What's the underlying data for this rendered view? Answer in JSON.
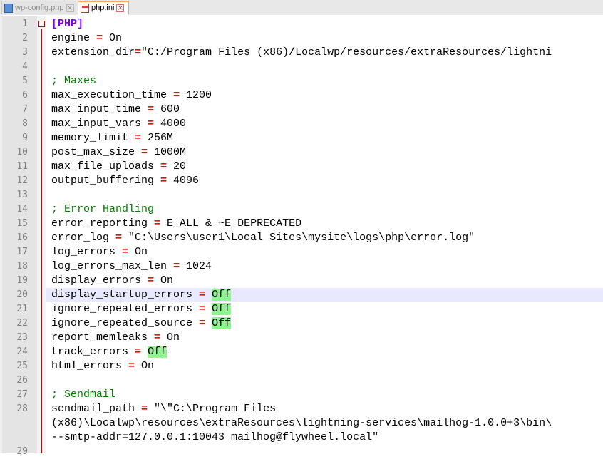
{
  "tabs": [
    {
      "label": "wp-config.php",
      "close": "×",
      "active": false
    },
    {
      "label": "php.ini",
      "close": "×",
      "active": true
    }
  ],
  "lines": [
    {
      "n": "1",
      "segs": [
        [
          "sec",
          "[PHP]"
        ]
      ]
    },
    {
      "n": "2",
      "segs": [
        [
          "",
          "engine "
        ],
        [
          "op",
          "="
        ],
        [
          "",
          " On"
        ]
      ]
    },
    {
      "n": "3",
      "segs": [
        [
          "",
          "extension_dir"
        ],
        [
          "op",
          "="
        ],
        [
          "",
          "\"C:/Program Files (x86)/Localwp/resources/extraResources/lightni"
        ]
      ]
    },
    {
      "n": "4",
      "segs": []
    },
    {
      "n": "5",
      "segs": [
        [
          "cmt",
          "; Maxes"
        ]
      ]
    },
    {
      "n": "6",
      "segs": [
        [
          "",
          "max_execution_time "
        ],
        [
          "op",
          "="
        ],
        [
          "",
          " 1200"
        ]
      ]
    },
    {
      "n": "7",
      "segs": [
        [
          "",
          "max_input_time "
        ],
        [
          "op",
          "="
        ],
        [
          "",
          " 600"
        ]
      ]
    },
    {
      "n": "8",
      "segs": [
        [
          "",
          "max_input_vars "
        ],
        [
          "op",
          "="
        ],
        [
          "",
          " 4000"
        ]
      ]
    },
    {
      "n": "9",
      "segs": [
        [
          "",
          "memory_limit "
        ],
        [
          "op",
          "="
        ],
        [
          "",
          " 256M"
        ]
      ]
    },
    {
      "n": "10",
      "segs": [
        [
          "",
          "post_max_size "
        ],
        [
          "op",
          "="
        ],
        [
          "",
          " 1000M"
        ]
      ]
    },
    {
      "n": "11",
      "segs": [
        [
          "",
          "max_file_uploads "
        ],
        [
          "op",
          "="
        ],
        [
          "",
          " 20"
        ]
      ]
    },
    {
      "n": "12",
      "segs": [
        [
          "",
          "output_buffering "
        ],
        [
          "op",
          "="
        ],
        [
          "",
          " 4096"
        ]
      ]
    },
    {
      "n": "13",
      "segs": []
    },
    {
      "n": "14",
      "segs": [
        [
          "cmt",
          "; Error Handling"
        ]
      ]
    },
    {
      "n": "15",
      "segs": [
        [
          "",
          "error_reporting "
        ],
        [
          "op",
          "="
        ],
        [
          "",
          " E_ALL & ~E_DEPRECATED"
        ]
      ]
    },
    {
      "n": "16",
      "segs": [
        [
          "",
          "error_log "
        ],
        [
          "op",
          "="
        ],
        [
          "",
          " \"C:\\Users\\user1\\Local Sites\\mysite\\logs\\php\\error.log\""
        ]
      ]
    },
    {
      "n": "17",
      "segs": [
        [
          "",
          "log_errors "
        ],
        [
          "op",
          "="
        ],
        [
          "",
          " On"
        ]
      ]
    },
    {
      "n": "18",
      "segs": [
        [
          "",
          "log_errors_max_len "
        ],
        [
          "op",
          "="
        ],
        [
          "",
          " 1024"
        ]
      ]
    },
    {
      "n": "19",
      "segs": [
        [
          "",
          "display_errors "
        ],
        [
          "op",
          "="
        ],
        [
          "",
          " On"
        ]
      ]
    },
    {
      "n": "20",
      "current": true,
      "segs": [
        [
          "",
          "display_startup_errors "
        ],
        [
          "op",
          "="
        ],
        [
          "",
          " "
        ],
        [
          "hl",
          "Off"
        ]
      ]
    },
    {
      "n": "21",
      "segs": [
        [
          "",
          "ignore_repeated_errors "
        ],
        [
          "op",
          "="
        ],
        [
          "",
          " "
        ],
        [
          "hl",
          "Off"
        ]
      ]
    },
    {
      "n": "22",
      "segs": [
        [
          "",
          "ignore_repeated_source "
        ],
        [
          "op",
          "="
        ],
        [
          "",
          " "
        ],
        [
          "hl",
          "Off"
        ]
      ]
    },
    {
      "n": "23",
      "segs": [
        [
          "",
          "report_memleaks "
        ],
        [
          "op",
          "="
        ],
        [
          "",
          " On"
        ]
      ]
    },
    {
      "n": "24",
      "segs": [
        [
          "",
          "track_errors "
        ],
        [
          "op",
          "="
        ],
        [
          "",
          " "
        ],
        [
          "hl",
          "Off"
        ]
      ]
    },
    {
      "n": "25",
      "segs": [
        [
          "",
          "html_errors "
        ],
        [
          "op",
          "="
        ],
        [
          "",
          " On"
        ]
      ]
    },
    {
      "n": "26",
      "segs": []
    },
    {
      "n": "27",
      "segs": [
        [
          "cmt",
          "; Sendmail"
        ]
      ]
    },
    {
      "n": "28",
      "segs": [
        [
          "",
          "sendmail_path "
        ],
        [
          "op",
          "="
        ],
        [
          "",
          " \"\\\"C:\\Program Files"
        ]
      ]
    },
    {
      "n": "",
      "segs": [
        [
          "",
          "(x86)\\Localwp\\resources\\extraResources\\lightning-services\\mailhog-1.0.0+3\\bin\\"
        ]
      ]
    },
    {
      "n": "",
      "segs": [
        [
          "",
          "--smtp-addr=127.0.0.1:10043 mailhog@flywheel.local\""
        ]
      ]
    },
    {
      "n": "29",
      "segs": []
    }
  ],
  "colors": {
    "section": "#8000ff",
    "comment": "#008000",
    "operator": "#ff0000",
    "match_highlight": "#8ff58f",
    "current_line": "#e8e8ff"
  },
  "icons": {
    "tab_0": "php-file-icon",
    "tab_1": "ini-file-icon",
    "fold": "fold-minus-icon"
  }
}
